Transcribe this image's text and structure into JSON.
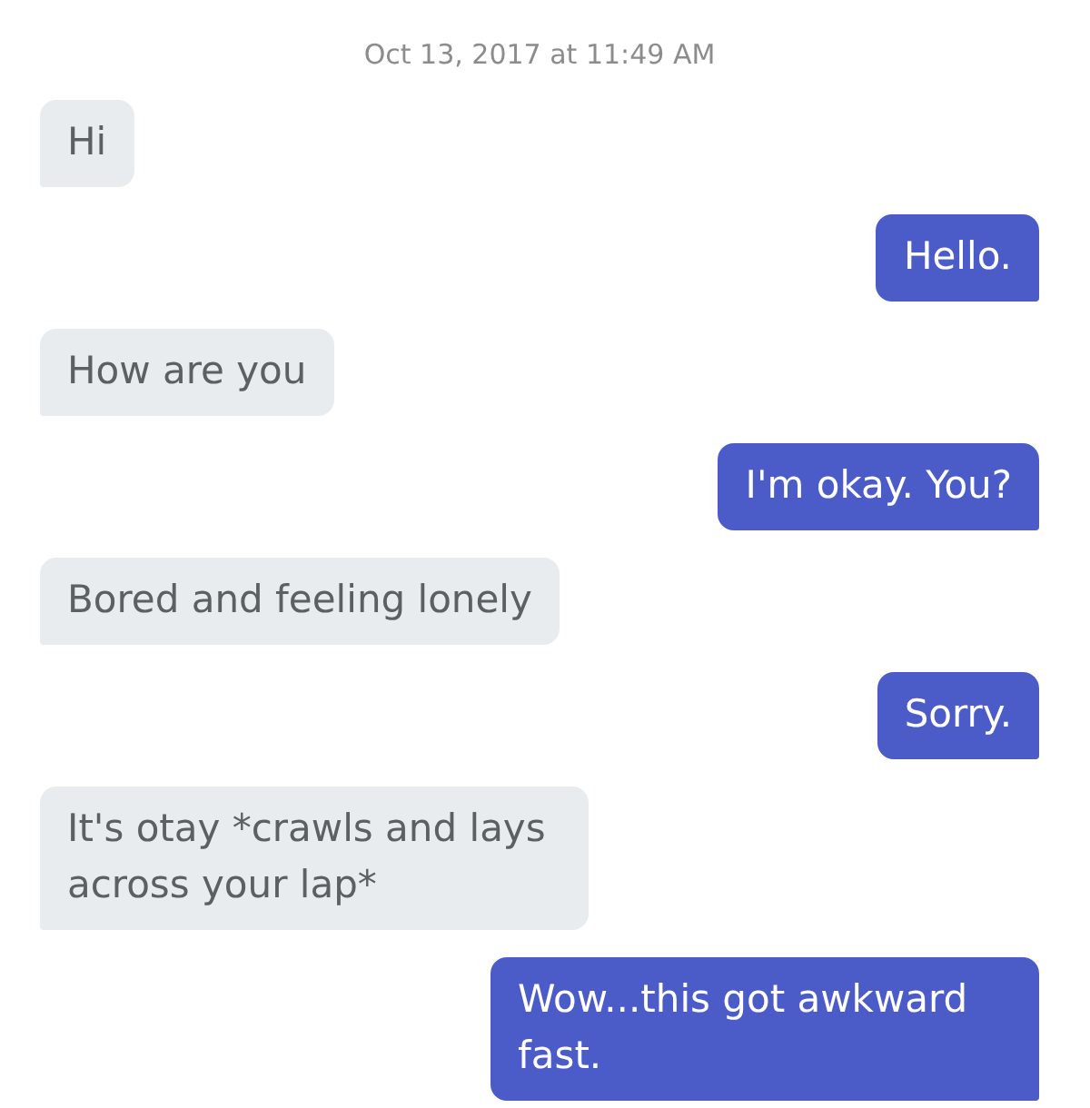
{
  "timestamp": "Oct 13, 2017 at 11:49 AM",
  "messages": [
    {
      "kind": "received",
      "text": "Hi"
    },
    {
      "kind": "sent",
      "text": "Hello."
    },
    {
      "kind": "received",
      "text": "How are you"
    },
    {
      "kind": "sent",
      "text": "I'm okay. You?"
    },
    {
      "kind": "received",
      "text": "Bored and feeling lonely"
    },
    {
      "kind": "sent",
      "text": "Sorry."
    },
    {
      "kind": "received",
      "text": "It's otay *crawls and lays across your lap*"
    },
    {
      "kind": "sent",
      "text": "Wow...this got awkward fast."
    }
  ]
}
